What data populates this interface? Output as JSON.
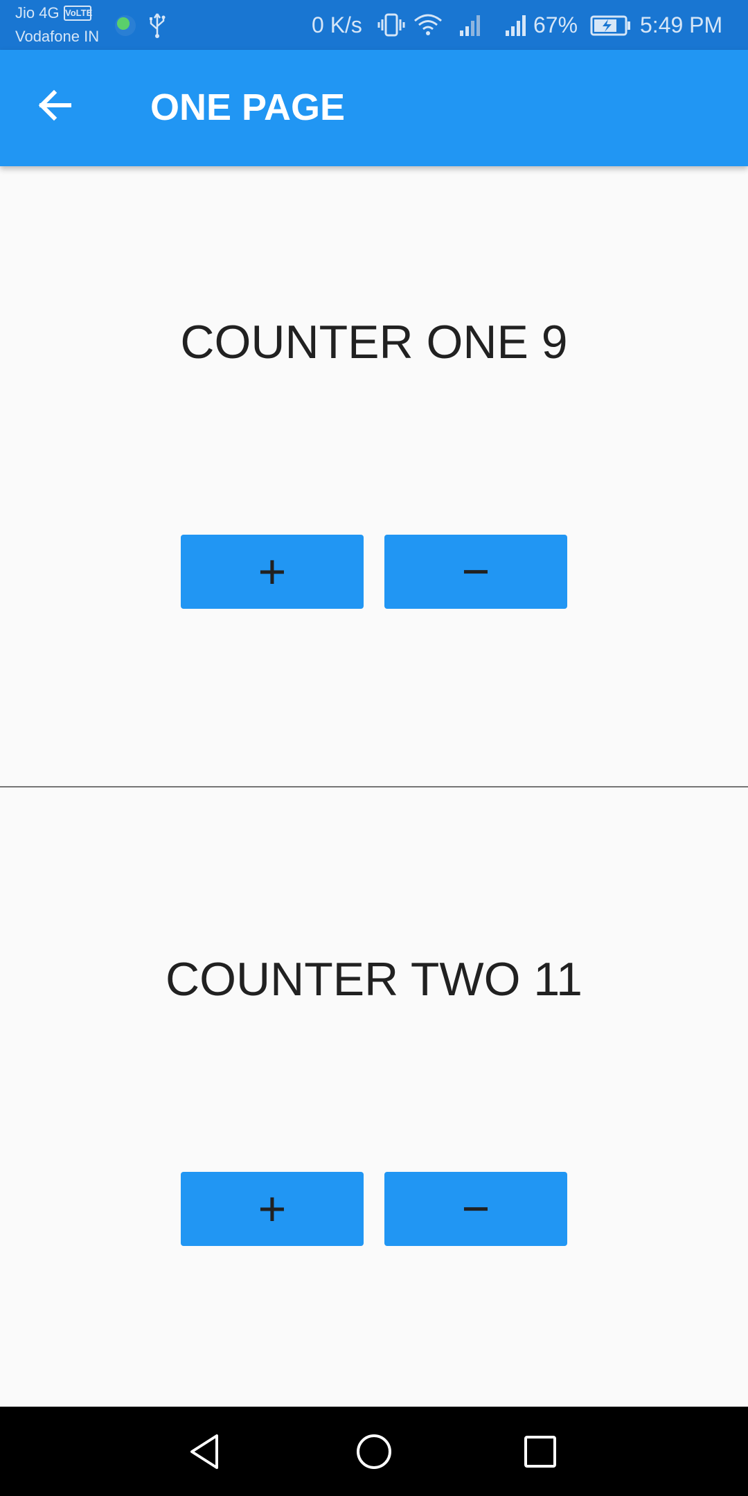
{
  "status_bar": {
    "carrier_primary": "Jio 4G",
    "volte_badge": "VoLTE",
    "carrier_secondary": "Vodafone IN",
    "net_speed": "0 K/s",
    "battery_percent": "67%",
    "time": "5:49 PM",
    "icons": [
      "globe-icon",
      "usb-icon",
      "vibrate-icon",
      "wifi-icon",
      "signal-icon",
      "signal-icon",
      "battery-charging-icon"
    ]
  },
  "app_bar": {
    "title": "ONE PAGE",
    "back_icon": "arrow-back-icon",
    "color": "#2196f3"
  },
  "counters": [
    {
      "label": "COUNTER ONE 9",
      "increment_label": "+",
      "decrement_label": "−"
    },
    {
      "label": "COUNTER TWO 11",
      "increment_label": "+",
      "decrement_label": "−"
    }
  ],
  "colors": {
    "accent": "#2196f3",
    "status_bar": "#1976d2",
    "background": "#fafafa",
    "text": "#212121",
    "nav_bar": "#000000"
  },
  "nav_bar": {
    "icons": [
      "back-triangle-icon",
      "home-circle-icon",
      "recents-square-icon"
    ]
  }
}
